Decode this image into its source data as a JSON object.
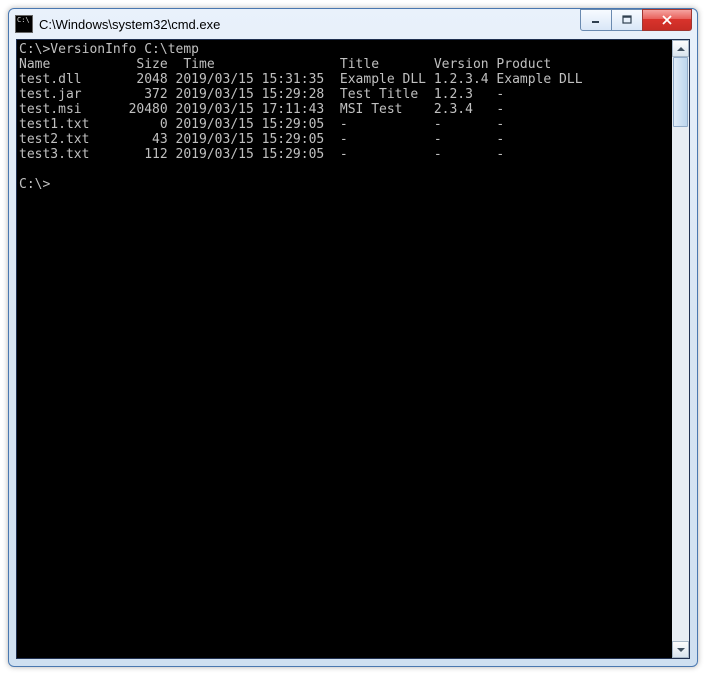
{
  "window": {
    "title": "C:\\Windows\\system32\\cmd.exe"
  },
  "terminal": {
    "prompt1": "C:\\>VersionInfo C:\\temp",
    "header": {
      "name": "Name",
      "size": "Size",
      "time": "Time",
      "title": "Title",
      "version": "Version",
      "product": "Product"
    },
    "rows": [
      {
        "name": "test.dll",
        "size": "2048",
        "date": "2019/03/15",
        "time": "15:31:35",
        "title": "Example DLL",
        "version": "1.2.3.4",
        "product": "Example DLL"
      },
      {
        "name": "test.jar",
        "size": "372",
        "date": "2019/03/15",
        "time": "15:29:28",
        "title": "Test Title",
        "version": "1.2.3",
        "product": "-"
      },
      {
        "name": "test.msi",
        "size": "20480",
        "date": "2019/03/15",
        "time": "17:11:43",
        "title": "MSI Test",
        "version": "2.3.4",
        "product": "-"
      },
      {
        "name": "test1.txt",
        "size": "0",
        "date": "2019/03/15",
        "time": "15:29:05",
        "title": "-",
        "version": "-",
        "product": "-"
      },
      {
        "name": "test2.txt",
        "size": "43",
        "date": "2019/03/15",
        "time": "15:29:05",
        "title": "-",
        "version": "-",
        "product": "-"
      },
      {
        "name": "test3.txt",
        "size": "112",
        "date": "2019/03/15",
        "time": "15:29:05",
        "title": "-",
        "version": "-",
        "product": "-"
      }
    ],
    "prompt2": "C:\\>"
  }
}
